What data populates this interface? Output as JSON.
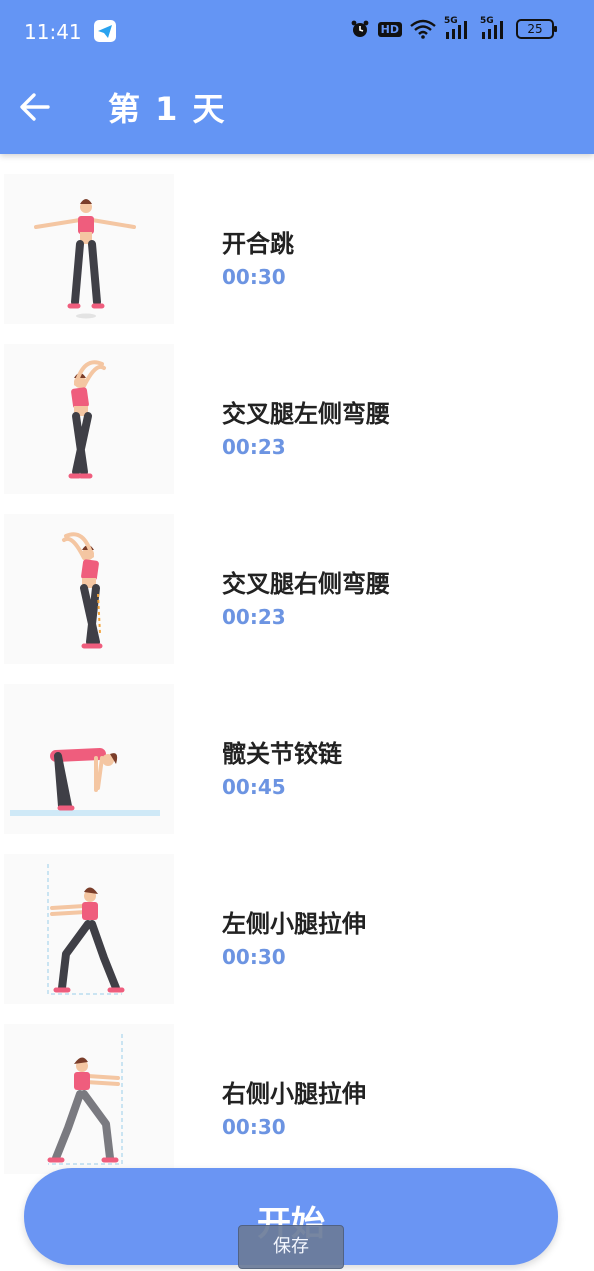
{
  "status_bar": {
    "time": "11:41",
    "network_badge": "HD",
    "signal_1": "5G",
    "signal_2": "5G",
    "battery": "25",
    "icons": [
      "telegram-icon",
      "alarm-icon",
      "hd-icon",
      "wifi-icon",
      "signal-5g-icon",
      "signal-5g-icon",
      "battery-icon"
    ]
  },
  "header": {
    "title": "第 1 天",
    "back_icon": "arrow-left-icon",
    "background": "#6495f4"
  },
  "exercises": [
    {
      "name": "开合跳",
      "duration": "00:30"
    },
    {
      "name": "交叉腿左侧弯腰",
      "duration": "00:23"
    },
    {
      "name": "交叉腿右侧弯腰",
      "duration": "00:23"
    },
    {
      "name": "髋关节铰链",
      "duration": "00:45"
    },
    {
      "name": "左侧小腿拉伸",
      "duration": "00:30"
    },
    {
      "name": "右侧小腿拉伸",
      "duration": "00:30"
    }
  ],
  "start_button": {
    "label": "开始",
    "color": "#6a95f3"
  },
  "tooltip": {
    "label": "保存"
  },
  "colors": {
    "duration_text": "#6c94e2",
    "name_text": "#222222"
  }
}
